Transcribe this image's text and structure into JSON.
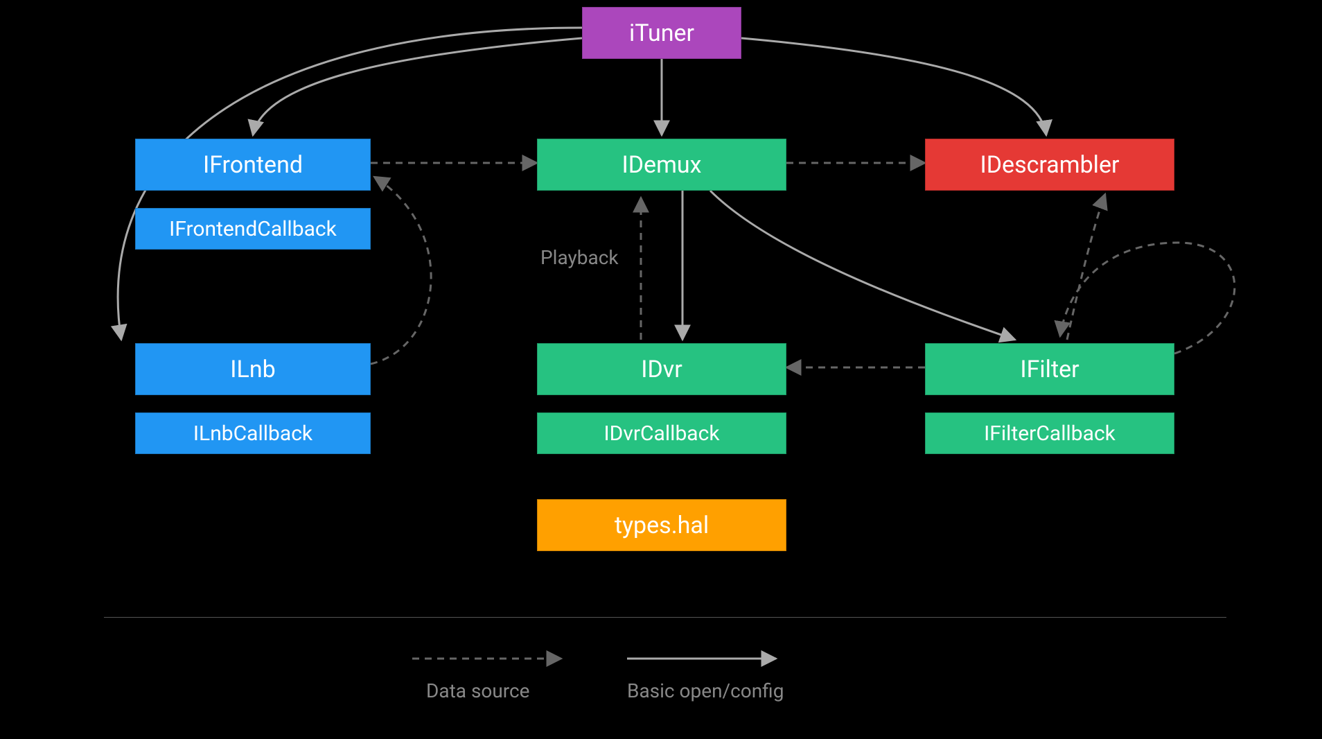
{
  "nodes": {
    "ituner": "iTuner",
    "ifrontend": "IFrontend",
    "ifrontendcallback": "IFrontendCallback",
    "idemux": "IDemux",
    "idescrambler": "IDescrambler",
    "ilnb": "ILnb",
    "ilnbcallback": "ILnbCallback",
    "idvr": "IDvr",
    "idvrcallback": "IDvrCallback",
    "ifilter": "IFilter",
    "ifiltercallback": "IFilterCallback",
    "typeshal": "types.hal"
  },
  "labels": {
    "playback": "Playback"
  },
  "legend": {
    "datasource": "Data source",
    "basicopen": "Basic open/config"
  },
  "colors": {
    "purple": "#ab47bc",
    "blue": "#2196f3",
    "green": "#26c281",
    "red": "#e53935",
    "orange": "#ffa000",
    "edge_solid": "#aaaaaa",
    "edge_dashed": "#666666"
  },
  "edges": [
    {
      "from": "iTuner",
      "to": "IFrontend",
      "style": "solid"
    },
    {
      "from": "iTuner",
      "to": "IDemux",
      "style": "solid"
    },
    {
      "from": "iTuner",
      "to": "IDescrambler",
      "style": "solid"
    },
    {
      "from": "iTuner",
      "to": "ILnb",
      "style": "solid"
    },
    {
      "from": "IFrontend",
      "to": "IDemux",
      "style": "dashed"
    },
    {
      "from": "IDemux",
      "to": "IDescrambler",
      "style": "dashed"
    },
    {
      "from": "IDemux",
      "to": "IDvr",
      "style": "solid"
    },
    {
      "from": "IDemux",
      "to": "IFilter",
      "style": "solid"
    },
    {
      "from": "IDvr",
      "to": "IDemux",
      "style": "dashed",
      "label": "Playback"
    },
    {
      "from": "ILnb",
      "to": "IFrontend",
      "style": "dashed"
    },
    {
      "from": "IFilter",
      "to": "IDvr",
      "style": "dashed"
    },
    {
      "from": "IFilter",
      "to": "IDescrambler",
      "style": "dashed"
    },
    {
      "from": "IFilter",
      "to": "IFilter",
      "style": "dashed"
    }
  ]
}
